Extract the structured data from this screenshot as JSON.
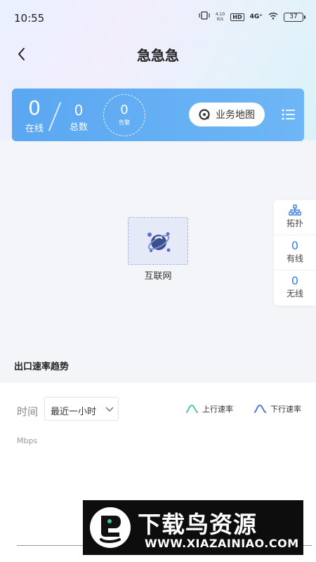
{
  "status_bar": {
    "time": "10:55",
    "net_speed": "4.10",
    "net_unit": "K/s",
    "hd": "HD",
    "signal": "4G⁺",
    "battery": "37"
  },
  "header": {
    "title": "急急急"
  },
  "stats": {
    "online_value": "0",
    "online_label": "在线",
    "total_value": "0",
    "total_label": "总数",
    "alarm_value": "0",
    "alarm_label": "告警",
    "map_button": "业务地图"
  },
  "topology": {
    "node_label": "互联网"
  },
  "side_panel": {
    "topo_label": "拓扑",
    "wired_value": "0",
    "wired_label": "有线",
    "wireless_value": "0",
    "wireless_label": "无线"
  },
  "trend": {
    "section_title": "出口速率趋势",
    "time_label": "时间",
    "time_selected": "最近一小时",
    "legend_up": "上行速率",
    "legend_down": "下行速率",
    "unit": "Mbps"
  },
  "watermark": {
    "title": "下载鸟资源",
    "url": "WWW.XIAZAINIAO.COM"
  },
  "colors": {
    "accent": "#5aa7f2",
    "up_line": "#3cc3a8",
    "down_line": "#3a6fe0"
  }
}
